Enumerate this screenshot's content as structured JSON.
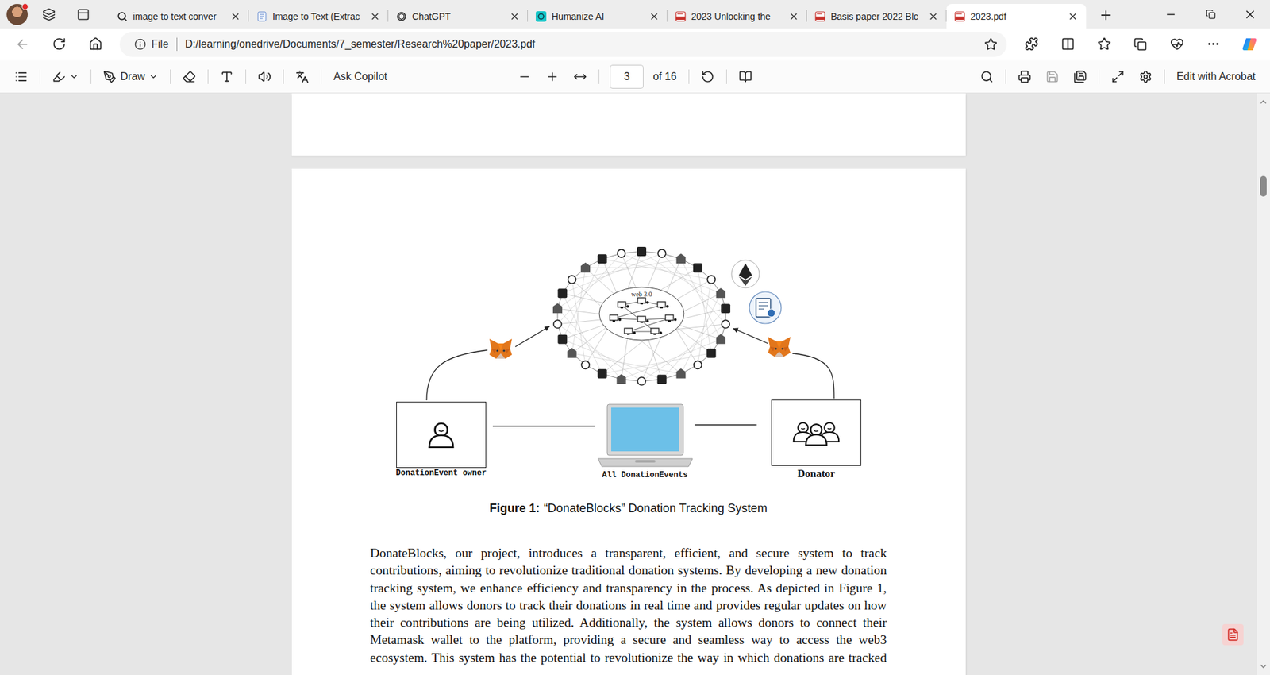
{
  "profile": {
    "notification": true
  },
  "tabs": [
    {
      "label": "image to text conver",
      "kind": "search",
      "selected": false
    },
    {
      "label": "Image to Text (Extrac",
      "kind": "doc",
      "selected": false
    },
    {
      "label": "ChatGPT",
      "kind": "chatgpt",
      "selected": false
    },
    {
      "label": "Humanize AI",
      "kind": "humanize",
      "selected": false
    },
    {
      "label": "2023 Unlocking the",
      "kind": "pdf",
      "selected": false
    },
    {
      "label": "Basis paper 2022 Blc",
      "kind": "pdf",
      "selected": false
    },
    {
      "label": "2023.pdf",
      "kind": "pdf",
      "selected": true
    }
  ],
  "navigation": {
    "back_disabled": true
  },
  "address_bar": {
    "scheme": "File",
    "url": "D:/learning/onedrive/Documents/7_semester/Research%20paper/2023.pdf",
    "favorite": false
  },
  "pdf_toolbar": {
    "draw": "Draw",
    "ask": "Ask Copilot",
    "page": "3",
    "page_total": "of 16",
    "save_disabled": true,
    "edit_button": "Edit with Acrobat"
  },
  "document": {
    "figure": {
      "cloud_label": "web 3.0",
      "owner": "DonationEvent owner",
      "events": "All DonationEvents",
      "donator": "Donator",
      "caption_label": "Figure 1:",
      "caption": "“DonateBlocks” Donation Tracking System"
    },
    "paragraph": "DonateBlocks, our project, introduces a transparent, efficient, and secure system to track contributions, aiming to revolutionize traditional donation systems. By developing a new donation tracking system, we enhance efficiency and transparency in the process. As depicted in Figure 1, the system allows donors to track their donations in real time and provides regular updates on how their contributions are being utilized. Additionally, the system allows donors to connect their Metamask wallet to the platform, providing a secure and seamless way to access the web3 ecosystem. This system has the potential to revolutionize the way in which donations are tracked"
  },
  "scroll": {
    "level": 0.13
  }
}
